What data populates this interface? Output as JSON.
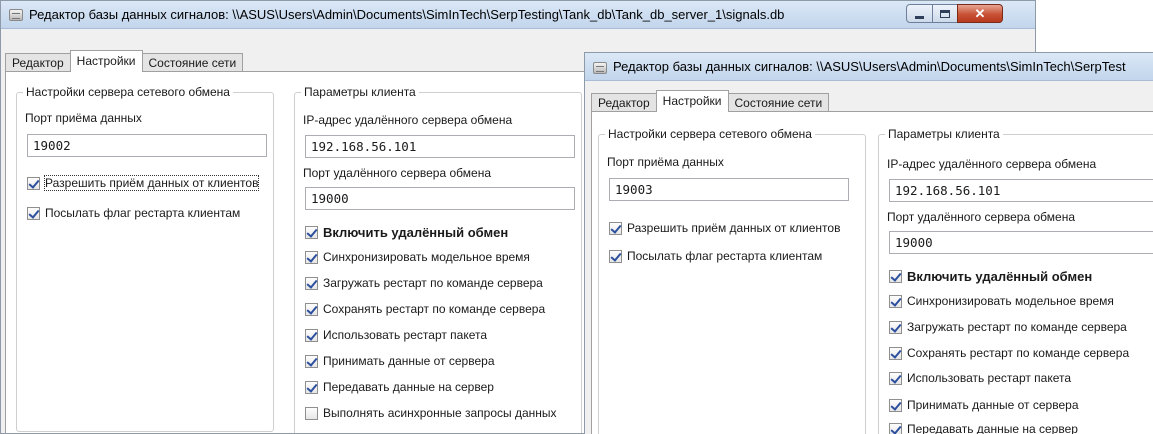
{
  "win1": {
    "title": "Редактор базы данных сигналов: \\\\ASUS\\Users\\Admin\\Documents\\SimInTech\\SerpTesting\\Tank_db\\Tank_db_server_1\\signals.db",
    "tabs": [
      "Редактор",
      "Настройки",
      "Состояние сети"
    ],
    "server": {
      "legend": "Настройки сервера сетевого обмена",
      "port_label": "Порт приёма данных",
      "port_value": "19002",
      "allow_label": "Разрешить приём данных от клиентов",
      "restart_flag_label": "Посылать флаг рестарта клиентам"
    },
    "client": {
      "legend": "Параметры клиента",
      "ip_label": "IP-адрес удалённого сервера обмена",
      "ip_value": "192.168.56.101",
      "remote_port_label": "Порт удалённого сервера обмена",
      "remote_port_value": "19000",
      "enable_label": "Включить удалённый обмен",
      "sync_label": "Синхронизировать модельное время",
      "load_restart_label": "Загружать рестарт по команде сервера",
      "save_restart_label": "Сохранять рестарт по команде сервера",
      "use_restart_label": "Использовать рестарт пакета",
      "receive_label": "Принимать данные от сервера",
      "send_label": "Передавать данные на сервер",
      "async_label": "Выполнять асинхронные запросы данных"
    }
  },
  "win2": {
    "title": "Редактор базы данных сигналов: \\\\ASUS\\Users\\Admin\\Documents\\SimInTech\\SerpTest",
    "tabs": [
      "Редактор",
      "Настройки",
      "Состояние сети"
    ],
    "server": {
      "legend": "Настройки сервера сетевого обмена",
      "port_label": "Порт приёма данных",
      "port_value": "19003",
      "allow_label": "Разрешить приём данных от клиентов",
      "restart_flag_label": "Посылать флаг рестарта клиентам"
    },
    "client": {
      "legend": "Параметры клиента",
      "ip_label": "IP-адрес удалённого сервера обмена",
      "ip_value": "192.168.56.101",
      "remote_port_label": "Порт удалённого сервера обмена",
      "remote_port_value": "19000",
      "enable_label": "Включить удалённый обмен",
      "sync_label": "Синхронизировать модельное время",
      "load_restart_label": "Загружать рестарт по команде сервера",
      "save_restart_label": "Сохранять рестарт по команде сервера",
      "use_restart_label": "Использовать рестарт пакета",
      "receive_label": "Принимать данные от сервера",
      "send_label": "Передавать данные на сервер"
    }
  },
  "colors": {
    "checkmark": "#2c4f9e",
    "close_button": "#c75236",
    "titlebar": "#c2d5ec"
  },
  "icons": {
    "app": "database-window-icon",
    "minimize": "minimize-icon",
    "maximize": "maximize-icon",
    "close": "close-icon"
  }
}
